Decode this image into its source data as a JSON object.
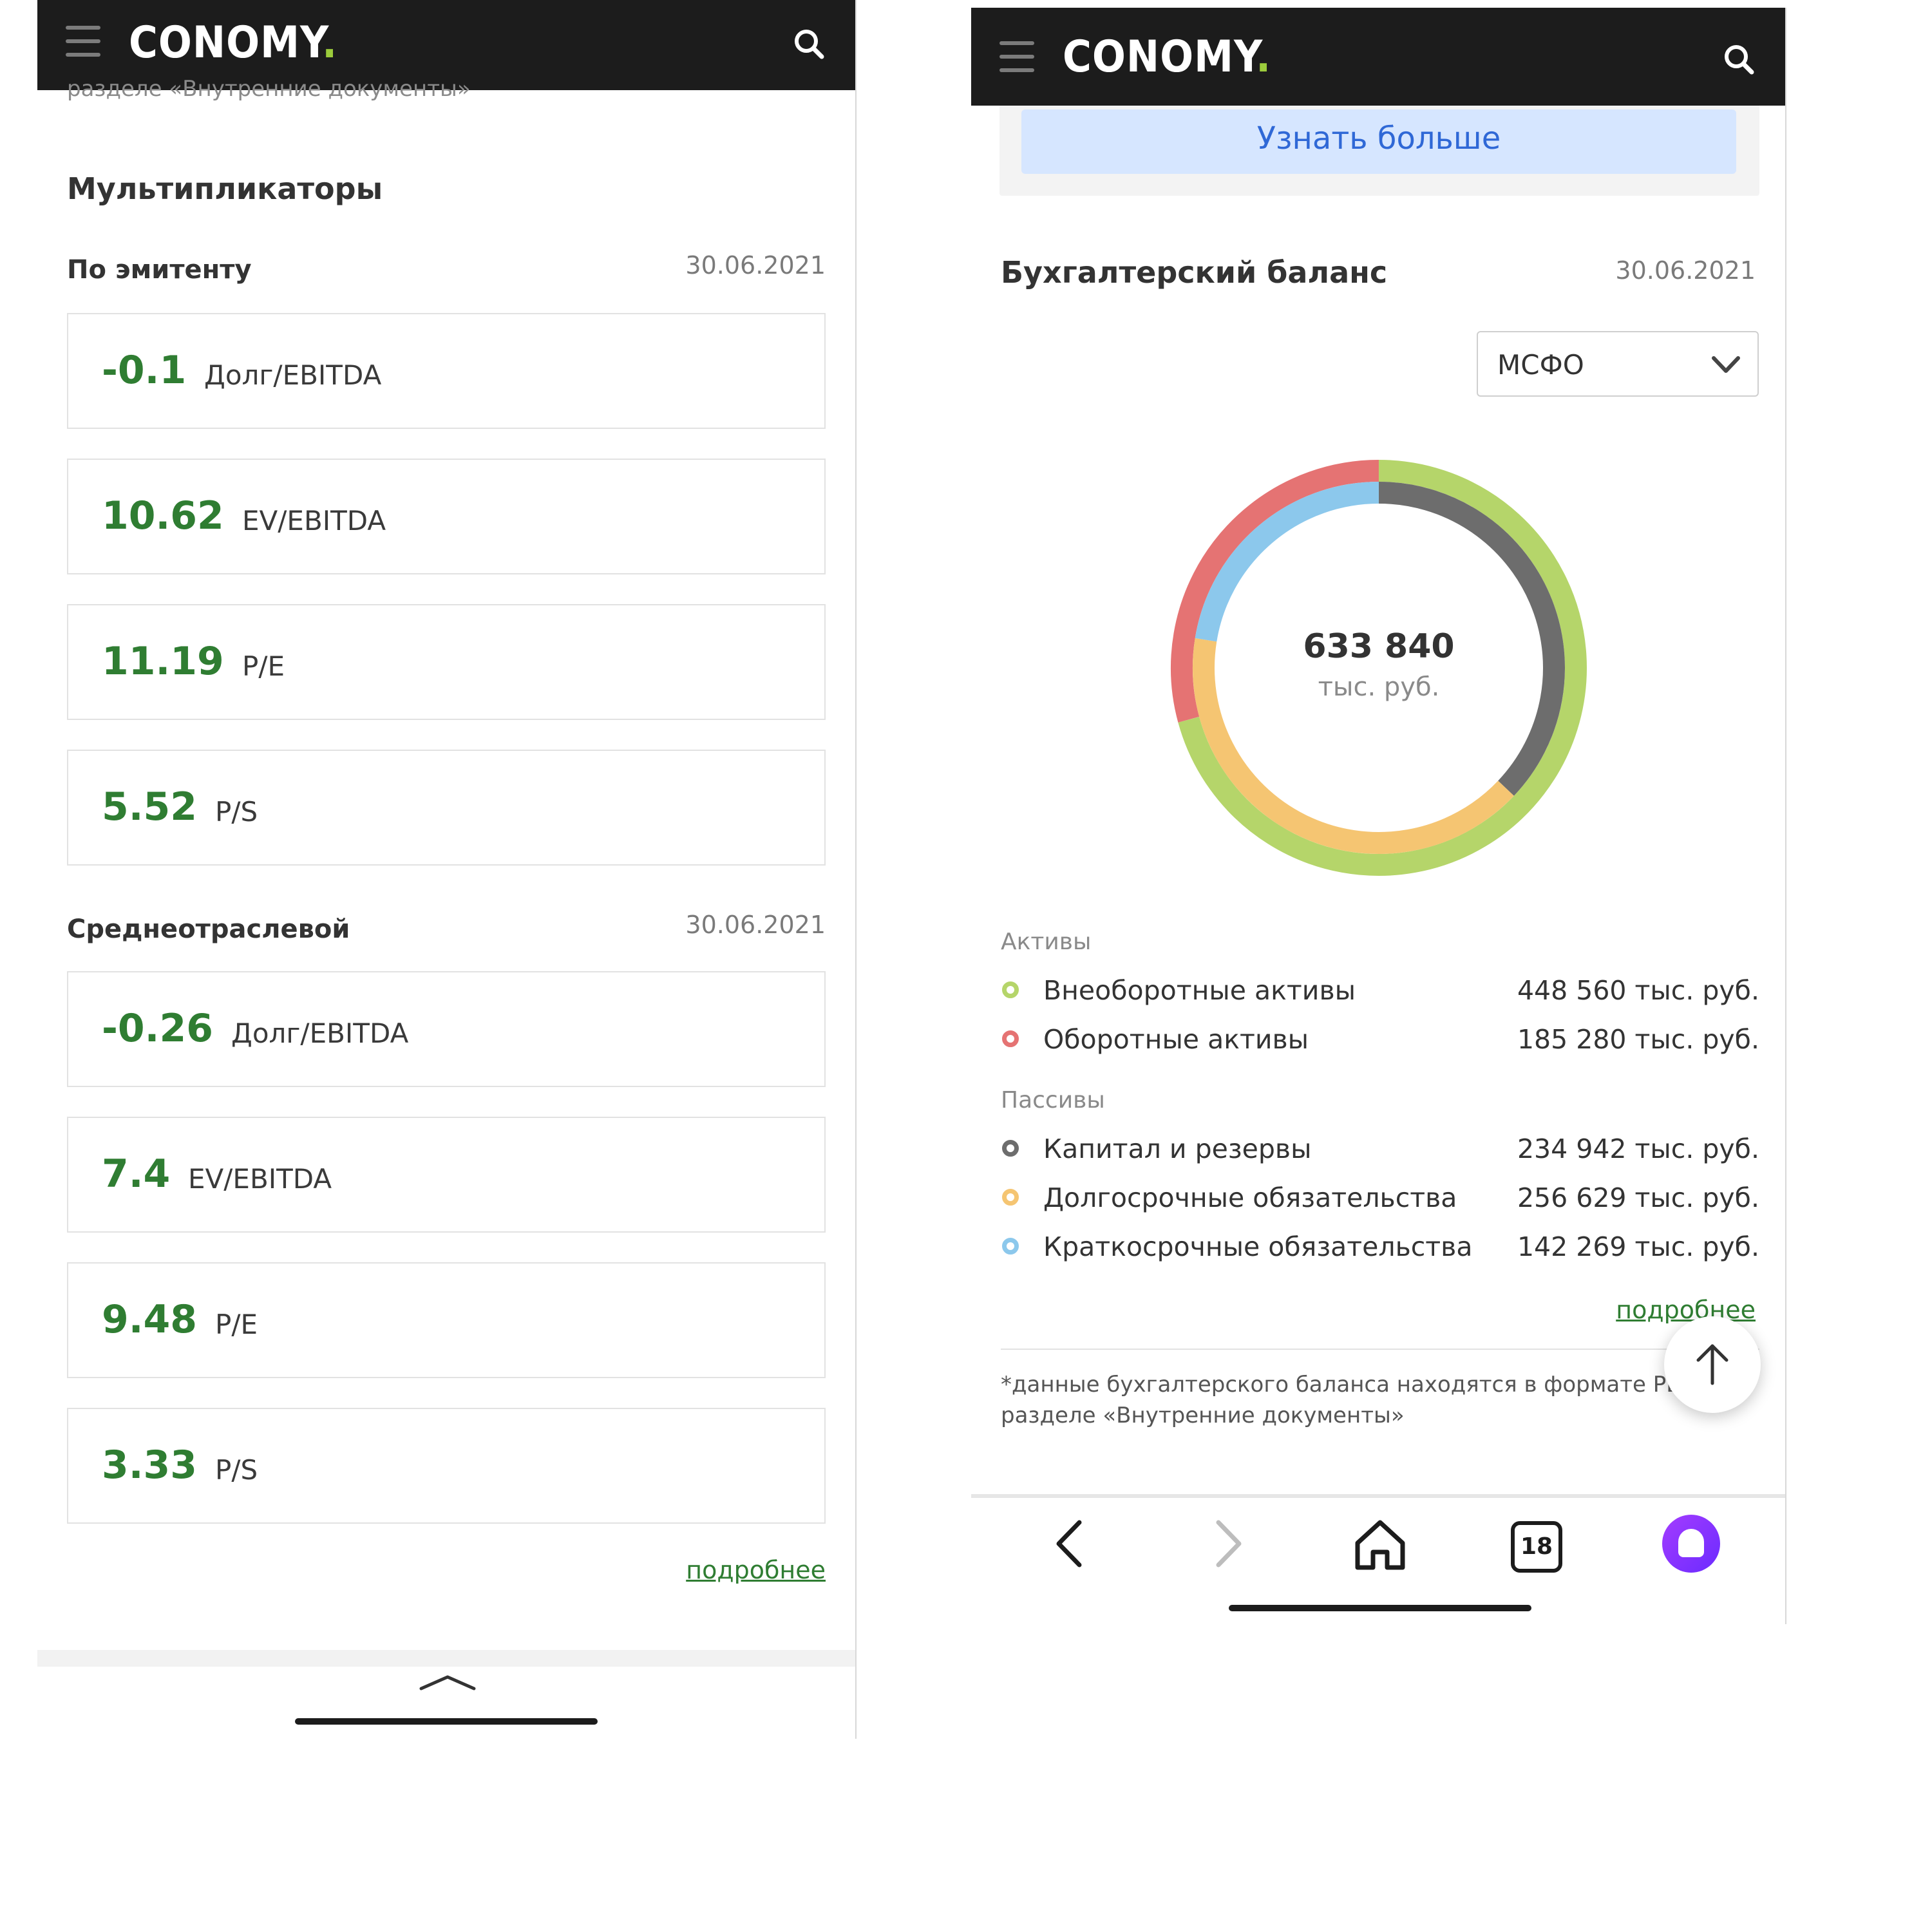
{
  "brand": {
    "logo_text": "CONOMY",
    "logo_dot": ".",
    "accent_color": "#9ccc3c"
  },
  "left": {
    "clipped_note": "разделе «Внутренние документы»",
    "section_title": "Мультипликаторы",
    "issuer": {
      "title": "По эмитенту",
      "date": "30.06.2021",
      "cards": [
        {
          "value": "-0.1",
          "label": "Долг/EBITDA"
        },
        {
          "value": "10.62",
          "label": "EV/EBITDA"
        },
        {
          "value": "11.19",
          "label": "P/E"
        },
        {
          "value": "5.52",
          "label": "P/S"
        }
      ]
    },
    "industry": {
      "title": "Среднеотраслевой",
      "date": "30.06.2021",
      "cards": [
        {
          "value": "-0.26",
          "label": "Долг/EBITDA"
        },
        {
          "value": "7.4",
          "label": "EV/EBITDA"
        },
        {
          "value": "9.48",
          "label": "P/E"
        },
        {
          "value": "3.33",
          "label": "P/S"
        }
      ]
    },
    "more_link": "подробнее",
    "value_color": "#2f7d32"
  },
  "right": {
    "promo_button": "Узнать больше",
    "balance_title": "Бухгалтерский баланс",
    "balance_date": "30.06.2021",
    "standard_select": "МСФО",
    "total_value": "633 840",
    "total_unit": "тыс. руб.",
    "assets_label": "Активы",
    "liabilities_label": "Пассивы",
    "more_link": "подробнее",
    "footnote": "*данные бухгалтерского баланса находятся в формате PDF в разделе «Внутренние документы»",
    "tab_count": "18"
  },
  "chart_data": {
    "type": "pie",
    "total": 633840,
    "unit": "тыс. руб.",
    "rings": [
      {
        "name": "Активы",
        "slices": [
          {
            "label": "Внеоборотные активы",
            "value": 448560,
            "display": "448 560 тыс. руб.",
            "color": "#b5d56a"
          },
          {
            "label": "Оборотные активы",
            "value": 185280,
            "display": "185 280 тыс. руб.",
            "color": "#e57373"
          }
        ]
      },
      {
        "name": "Пассивы",
        "slices": [
          {
            "label": "Капитал и резервы",
            "value": 234942,
            "display": "234 942 тыс. руб.",
            "color": "#6d6d6d"
          },
          {
            "label": "Долгосрочные обязательства",
            "value": 256629,
            "display": "256 629 тыс. руб.",
            "color": "#f5c572"
          },
          {
            "label": "Краткосрочные обязательства",
            "value": 142269,
            "display": "142 269 тыс. руб.",
            "color": "#8cc8ec"
          }
        ]
      }
    ]
  }
}
